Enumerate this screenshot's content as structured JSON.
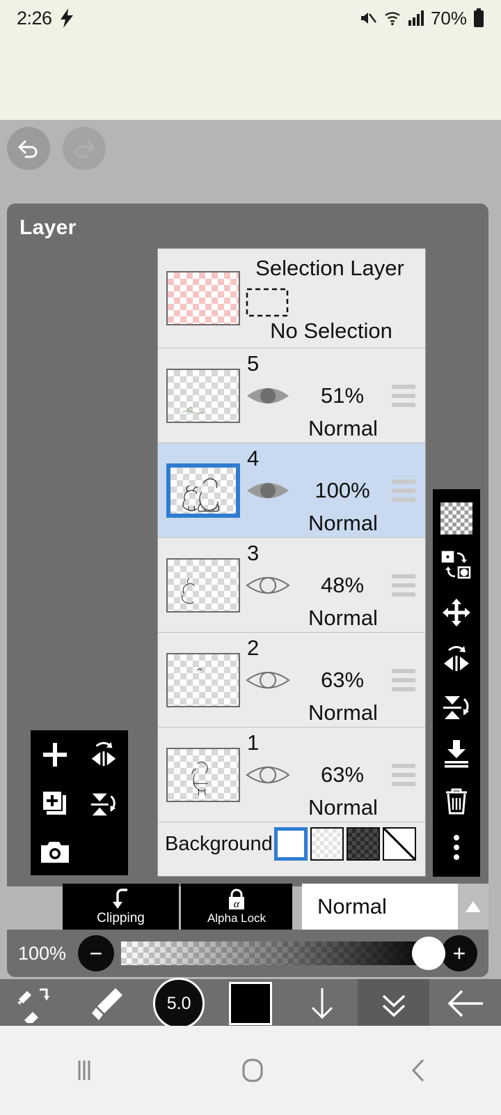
{
  "status_bar": {
    "time": "2:26",
    "charging_icon": "lightning-bolt-icon",
    "mute_icon": "mute-icon",
    "wifi_icon": "wifi-icon",
    "signal_icon": "cellular-signal-icon",
    "battery_percent": "70%",
    "battery_icon": "battery-icon"
  },
  "top_controls": {
    "undo_icon": "undo-icon",
    "redo_icon": "redo-icon"
  },
  "panel": {
    "title": "Layer"
  },
  "selection_layer": {
    "title": "Selection Layer",
    "status": "No Selection",
    "icon": "dashed-rectangle-icon"
  },
  "layers": [
    {
      "number": "5",
      "opacity": "51%",
      "blend": "Normal",
      "visible": true,
      "selected": false
    },
    {
      "number": "4",
      "opacity": "100%",
      "blend": "Normal",
      "visible": true,
      "selected": true
    },
    {
      "number": "3",
      "opacity": "48%",
      "blend": "Normal",
      "visible": false,
      "selected": false
    },
    {
      "number": "2",
      "opacity": "63%",
      "blend": "Normal",
      "visible": false,
      "selected": false
    },
    {
      "number": "1",
      "opacity": "63%",
      "blend": "Normal",
      "visible": false,
      "selected": false
    }
  ],
  "background": {
    "label": "Background",
    "options": [
      "white",
      "light-checker",
      "dark-checker",
      "none-diagonal"
    ],
    "selected_index": 0
  },
  "right_toolbar": {
    "items": [
      {
        "icon": "transparency-checker-icon"
      },
      {
        "icon": "swap-layers-icon"
      },
      {
        "icon": "move-layer-icon"
      },
      {
        "icon": "flip-horizontal-icon"
      },
      {
        "icon": "flip-vertical-icon"
      },
      {
        "icon": "merge-down-icon"
      },
      {
        "icon": "delete-layer-icon"
      },
      {
        "icon": "more-options-icon"
      }
    ]
  },
  "left_toolbar": {
    "items": [
      {
        "icon": "add-layer-icon"
      },
      {
        "icon": "flip-horizontal-icon"
      },
      {
        "icon": "duplicate-layer-icon"
      },
      {
        "icon": "flip-vertical-icon"
      },
      {
        "icon": "camera-import-icon"
      }
    ]
  },
  "action_bar": {
    "clipping_label": "Clipping",
    "clipping_icon": "clipping-arrow-icon",
    "alpha_lock_label": "Alpha Lock",
    "alpha_lock_icon": "alpha-lock-icon",
    "blend_mode": "Normal",
    "blend_arrow_icon": "triangle-up-icon"
  },
  "opacity_slider": {
    "value_label": "100%",
    "minus_label": "−",
    "plus_label": "+",
    "fill_percent": 100
  },
  "bottom_toolbar": {
    "items": [
      {
        "icon": "brush-eraser-switch-icon"
      },
      {
        "icon": "brush-icon"
      },
      {
        "icon": "brush-size-icon",
        "label": "5.0"
      },
      {
        "icon": "color-swatch-icon"
      },
      {
        "icon": "download-arrow-icon"
      },
      {
        "icon": "collapse-chevrons-icon"
      },
      {
        "icon": "back-arrow-icon"
      }
    ]
  },
  "android_nav": {
    "recents_icon": "recents-icon",
    "home_icon": "home-icon",
    "back_icon": "back-icon"
  }
}
